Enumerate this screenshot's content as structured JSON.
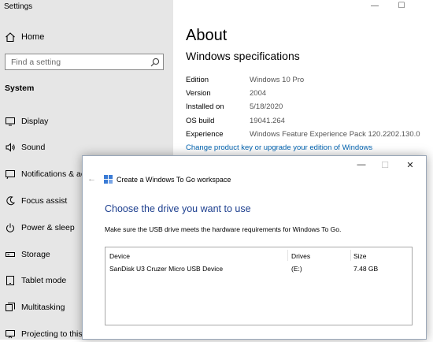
{
  "settings": {
    "window_title": "Settings",
    "home_label": "Home",
    "search_placeholder": "Find a setting",
    "section_label": "System",
    "nav_items": [
      {
        "label": "Display",
        "icon": "display-icon"
      },
      {
        "label": "Sound",
        "icon": "sound-icon"
      },
      {
        "label": "Notifications & actions",
        "icon": "notifications-icon"
      },
      {
        "label": "Focus assist",
        "icon": "focus-assist-icon"
      },
      {
        "label": "Power & sleep",
        "icon": "power-icon"
      },
      {
        "label": "Storage",
        "icon": "storage-icon"
      },
      {
        "label": "Tablet mode",
        "icon": "tablet-icon"
      },
      {
        "label": "Multitasking",
        "icon": "multitasking-icon"
      },
      {
        "label": "Projecting to this PC",
        "icon": "projecting-icon"
      }
    ],
    "window_controls": {
      "minimize": "—",
      "maximize": "☐"
    }
  },
  "about": {
    "title": "About",
    "spec_title": "Windows specifications",
    "specs": [
      {
        "key": "Edition",
        "value": "Windows 10 Pro"
      },
      {
        "key": "Version",
        "value": "2004"
      },
      {
        "key": "Installed on",
        "value": "5/18/2020"
      },
      {
        "key": "OS build",
        "value": "19041.264"
      },
      {
        "key": "Experience",
        "value": "Windows Feature Experience Pack 120.2202.130.0"
      }
    ],
    "link": "Change product key or upgrade your edition of Windows"
  },
  "dialog": {
    "back": "←",
    "title": "Create a Windows To Go workspace",
    "minimize": "—",
    "maximize": "☐",
    "close": "✕",
    "heading": "Choose the drive you want to use",
    "instruction": "Make sure the USB drive meets the hardware requirements for Windows To Go.",
    "columns": [
      "Device",
      "Drives",
      "Size"
    ],
    "rows": [
      {
        "device": "SanDisk U3 Cruzer Micro USB Device",
        "drive": "(E:)",
        "size": "7.48 GB"
      }
    ]
  },
  "colors": {
    "sidebar_bg": "#e6e6e6",
    "link": "#0063b1",
    "heading": "#1c3e8e"
  }
}
